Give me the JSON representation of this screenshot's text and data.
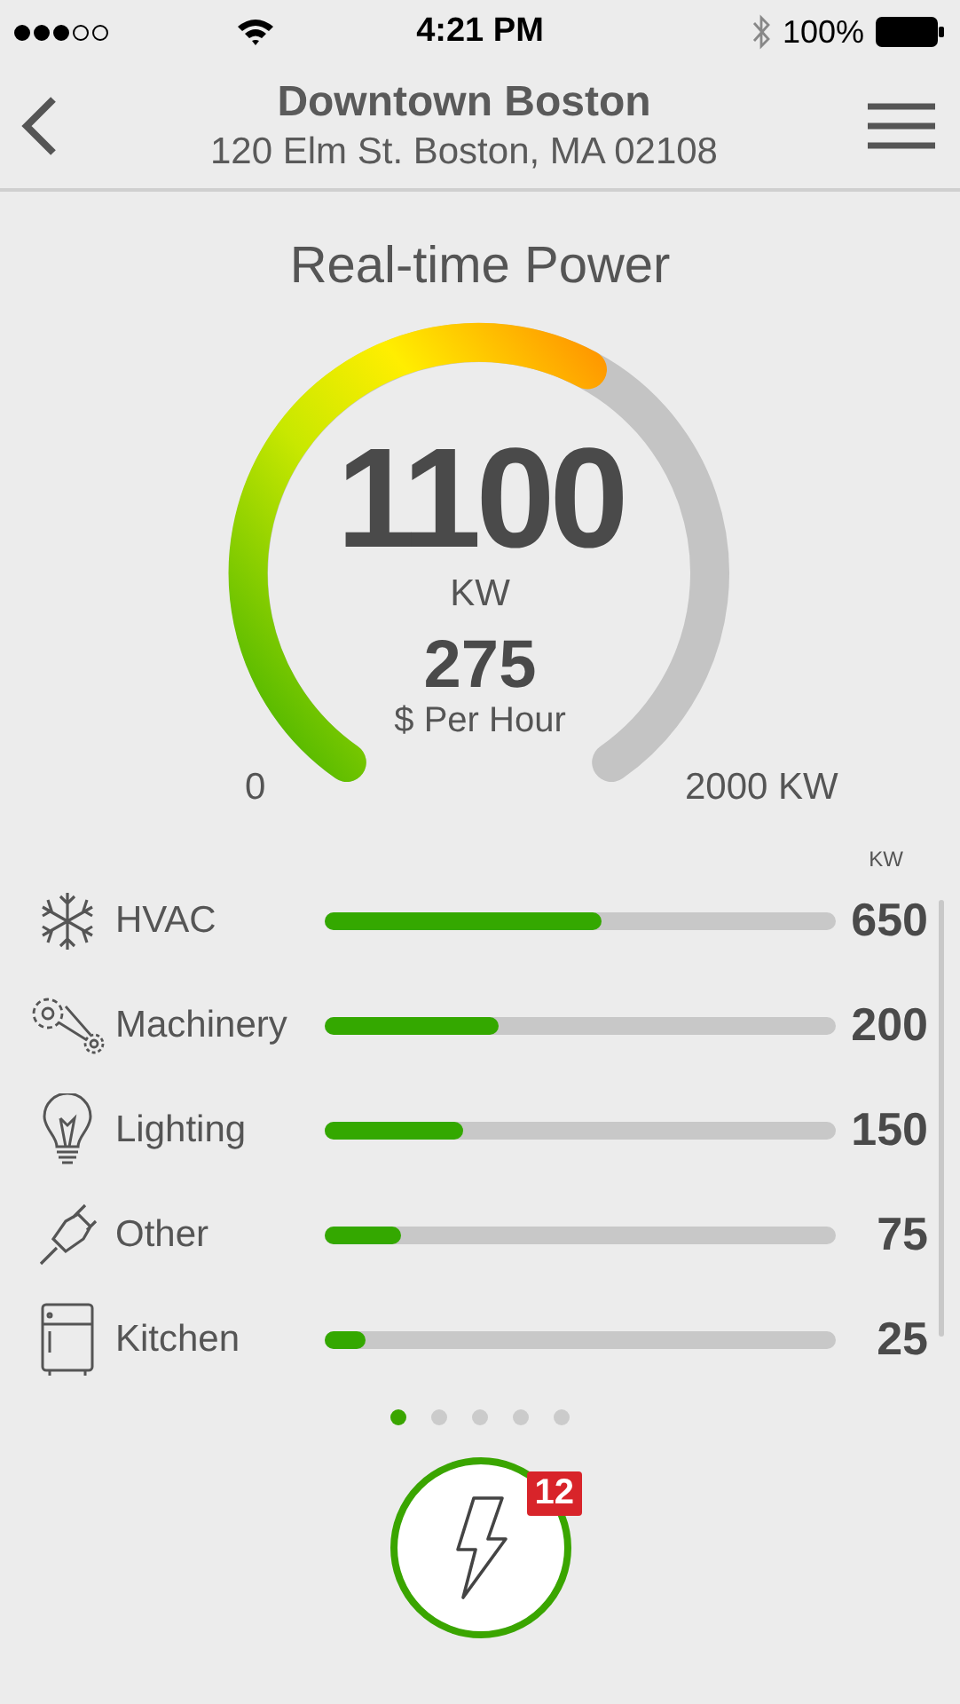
{
  "status_bar": {
    "signal_dots": [
      {
        "filled": true
      },
      {
        "filled": true
      },
      {
        "filled": true
      },
      {
        "filled": false
      },
      {
        "filled": false
      }
    ],
    "time": "4:21 PM",
    "battery": "100%"
  },
  "nav": {
    "title": "Downtown Boston",
    "subtitle": "120 Elm St. Boston, MA 02108"
  },
  "gauge": {
    "title": "Real-time Power",
    "value": "1100",
    "unit": "KW",
    "cost": "275",
    "cost_label": "$ Per Hour",
    "min": "0",
    "max": "2000 KW"
  },
  "breakdown": {
    "unit": "KW",
    "items": [
      {
        "kind": "snowflake",
        "label": "HVAC",
        "level": 0.54,
        "value": "650"
      },
      {
        "kind": "gears",
        "label": "Machinery",
        "level": 0.34,
        "value": "200"
      },
      {
        "kind": "bulb",
        "label": "Lighting",
        "level": 0.27,
        "value": "150"
      },
      {
        "kind": "plug",
        "label": "Other",
        "level": 0.15,
        "value": "75"
      },
      {
        "kind": "fridge",
        "label": "Kitchen",
        "level": 0.08,
        "value": "25"
      }
    ]
  },
  "pages": [
    {
      "selected": true
    },
    {
      "selected": false
    },
    {
      "selected": false
    },
    {
      "selected": false
    },
    {
      "selected": false
    }
  ],
  "alert_button": {
    "badge": "12"
  }
}
